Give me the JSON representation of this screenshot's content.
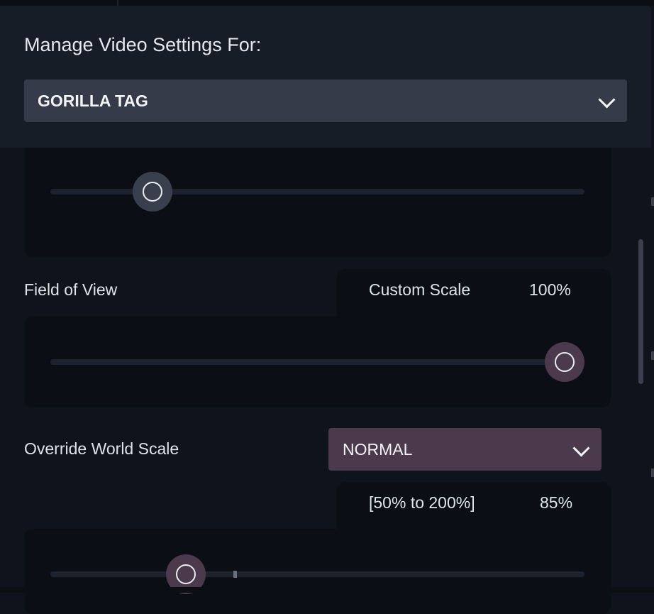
{
  "header": {
    "title": "Manage Video Settings For:"
  },
  "game_select": {
    "selected": "GORILLA TAG",
    "icon": "chevron-down-icon"
  },
  "slider_1": {
    "value_fraction": 0.19
  },
  "field_of_view": {
    "label": "Field of View",
    "mode": "Custom Scale",
    "value": "100%",
    "slider_fraction": 1.0
  },
  "world_scale": {
    "label": "Override World Scale",
    "selected": "NORMAL",
    "range": "[50% to 200%]",
    "value": "85%",
    "slider_fraction": 0.25,
    "accent": "#4a3a4c"
  },
  "colors": {
    "knob_default": "#3a3f4d",
    "knob_accent": "#4a3a4c",
    "panel": "#0b0e14"
  }
}
